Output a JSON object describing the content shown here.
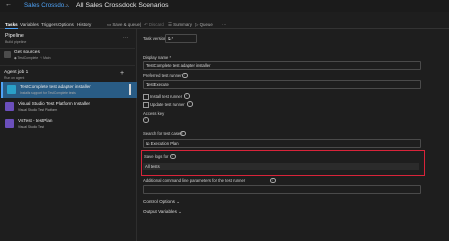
{
  "header": {
    "back_icon": "arrow-left-icon",
    "breadcrumb": "Sales Crossdo...",
    "separator": "›",
    "title": "All Sales Crossdock Scenarios"
  },
  "tabs": [
    "Tasks",
    "Variables",
    "Triggers",
    "Options",
    "History"
  ],
  "toolbar": {
    "save_queue": "Save & queue",
    "discard": "Discard",
    "summary": "Summary",
    "queue": "Queue",
    "more": "···"
  },
  "sidebar": {
    "pipeline_title": "Pipeline",
    "pipeline_sub": "Build pipeline",
    "more": "···",
    "get_sources": {
      "title": "Get sources",
      "repo": "TestComplete",
      "branch": "Main"
    },
    "agent_job": {
      "title": "Agent job 1",
      "sub": "Run on agent",
      "add": "+"
    },
    "tasks": [
      {
        "title": "TestComplete test adapter installer",
        "sub": "Installs support for TestComplete tests",
        "icon_color": "#2aa0c8"
      },
      {
        "title": "Visual Studio Test Platform Installer",
        "sub": "Visual Studio Test Platform",
        "icon_color": "#6b4fbb"
      },
      {
        "title": "VsTest - testPlan",
        "sub": "Visual Studio Test",
        "icon_color": "#6b4fbb"
      }
    ]
  },
  "form": {
    "task_version_label": "Task version",
    "task_version": "0.*",
    "display_name_label": "Display name *",
    "display_name": "TestComplete test adapter installer",
    "preferred_runner_label": "Preferred test runner",
    "preferred_runner": "TestExecute",
    "install_runner_label": "Install test runner",
    "update_runner_label": "Update test runner",
    "access_key_label": "Access key",
    "search_label": "Search for test cases",
    "search_value": "In Execution Plan",
    "save_logs_label": "Save logs for",
    "save_logs_value": "All tests",
    "cmd_params_label": "Additional command line parameters for the test runner",
    "control_options": "Control Options",
    "output_variables": "Output Variables"
  },
  "colors": {
    "accent": "#4fa3f7",
    "highlight": "#d9243a"
  }
}
